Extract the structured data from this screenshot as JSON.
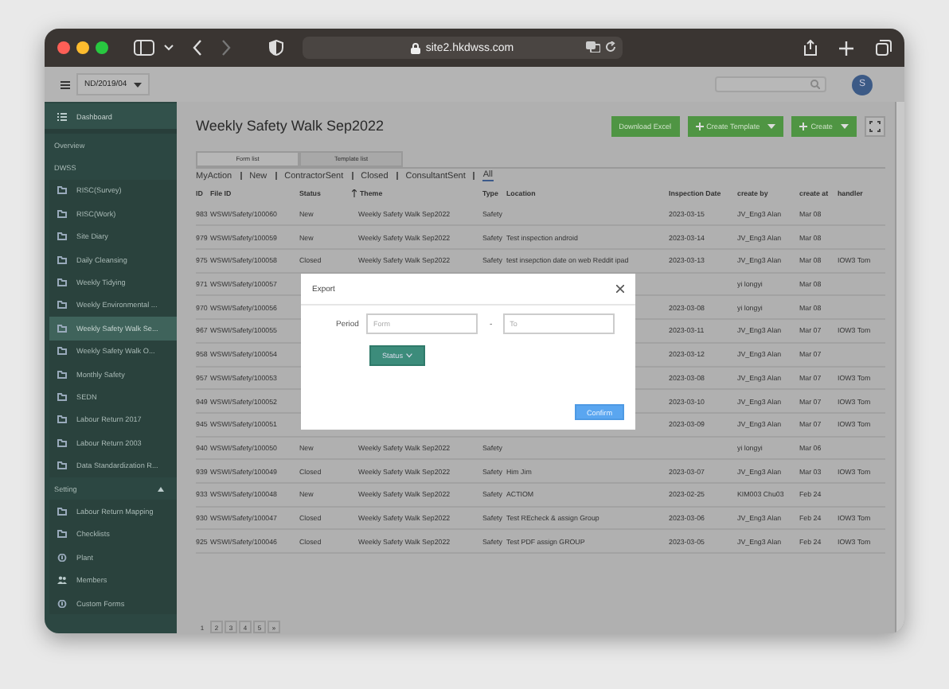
{
  "browser": {
    "url": "site2.hkdwss.com"
  },
  "header": {
    "project": "ND/2019/04",
    "avatar": "S"
  },
  "sidebar": {
    "items": [
      {
        "label": "Dashboard",
        "kind": "list",
        "selected": false
      },
      {
        "label": "Overview",
        "kind": "link",
        "selected": false
      },
      {
        "label": "DWSS",
        "kind": "heading",
        "selected": false
      },
      {
        "label": "RISC(Survey)",
        "kind": "folder",
        "selected": false
      },
      {
        "label": "RISC(Work)",
        "kind": "folder",
        "selected": false
      },
      {
        "label": "Site Diary",
        "kind": "folder",
        "selected": false
      },
      {
        "label": "Daily Cleansing",
        "kind": "folder",
        "selected": false
      },
      {
        "label": "Weekly Tidying",
        "kind": "folder",
        "selected": false
      },
      {
        "label": "Weekly Environmental ...",
        "kind": "folder",
        "selected": false
      },
      {
        "label": "Weekly Safety Walk Se...",
        "kind": "folder",
        "selected": true
      },
      {
        "label": "Weekly Safety Walk O...",
        "kind": "folder",
        "selected": false
      },
      {
        "label": "Monthly Safety",
        "kind": "folder",
        "selected": false
      },
      {
        "label": "SEDN",
        "kind": "folder",
        "selected": false
      },
      {
        "label": "Labour Return 2017",
        "kind": "folder",
        "selected": false
      },
      {
        "label": "Labour Return 2003",
        "kind": "folder",
        "selected": false
      },
      {
        "label": "Data Standardization R...",
        "kind": "folder",
        "selected": false
      },
      {
        "label": "Setting",
        "kind": "heading",
        "selected": false,
        "expanded": true
      },
      {
        "label": "Labour Return Mapping",
        "kind": "folder",
        "selected": false
      },
      {
        "label": "Checklists",
        "kind": "folder",
        "selected": false
      },
      {
        "label": "Plant",
        "kind": "circle",
        "selected": false
      },
      {
        "label": "Members",
        "kind": "people",
        "selected": false
      },
      {
        "label": "Custom Forms",
        "kind": "circle",
        "selected": false
      }
    ]
  },
  "page": {
    "title": "Weekly Safety Walk Sep2022",
    "buttons": [
      {
        "label": "Download Excel",
        "kind": "plain"
      },
      {
        "label": "Create Template",
        "kind": "dropdown"
      },
      {
        "label": "Create",
        "kind": "dropdown"
      }
    ],
    "tabs": [
      {
        "label": "Form list",
        "selected": true
      },
      {
        "label": "Template list",
        "selected": false
      }
    ],
    "filters": [
      {
        "label": "MyAction",
        "selected": false
      },
      {
        "label": "New",
        "selected": false
      },
      {
        "label": "ContractorSent",
        "selected": false
      },
      {
        "label": "Closed",
        "selected": false
      },
      {
        "label": "ConsultantSent",
        "selected": false
      },
      {
        "label": "All",
        "selected": true
      }
    ]
  },
  "table": {
    "columns": [
      "ID",
      "File ID",
      "Status",
      "Theme",
      "Type",
      "Location",
      "Inspection Date",
      "create by",
      "create at",
      "handler"
    ],
    "rows": [
      {
        "id": "983",
        "file_id": "WSWI/Safety/100060",
        "status": "New",
        "theme": "Weekly Safety Walk Sep2022",
        "type": "Safety",
        "date": "2023-03-15",
        "create_by": "JV_Eng3 Alan",
        "create_at": "Mar 08"
      },
      {
        "id": "979",
        "file_id": "WSWI/Safety/100059",
        "status": "New",
        "theme": "Weekly Safety Walk Sep2022",
        "type": "Safety",
        "location": "Test inspection android",
        "date": "2023-03-14",
        "create_by": "JV_Eng3 Alan",
        "create_at": "Mar 08"
      },
      {
        "id": "975",
        "file_id": "WSWI/Safety/100058",
        "status": "Closed",
        "theme": "Weekly Safety Walk Sep2022",
        "type": "Safety",
        "location": "test insepction date on web Reddit ipad",
        "date": "2023-03-13",
        "create_by": "JV_Eng3 Alan",
        "create_at": "Mar 08",
        "handler": "IOW3 Tom"
      },
      {
        "id": "971",
        "file_id": "WSWI/Safety/100057",
        "create_by": "yi longyi",
        "create_at": "Mar 08"
      },
      {
        "id": "970",
        "file_id": "WSWI/Safety/100056",
        "date": "2023-03-08",
        "create_by": "yi longyi",
        "create_at": "Mar 08"
      },
      {
        "id": "967",
        "file_id": "WSWI/Safety/100055",
        "date": "2023-03-11",
        "create_by": "JV_Eng3 Alan",
        "create_at": "Mar 07",
        "handler": "IOW3 Tom"
      },
      {
        "id": "958",
        "file_id": "WSWI/Safety/100054",
        "date": "2023-03-12",
        "create_by": "JV_Eng3 Alan",
        "create_at": "Mar 07"
      },
      {
        "id": "957",
        "file_id": "WSWI/Safety/100053",
        "date": "2023-03-08",
        "create_by": "JV_Eng3 Alan",
        "create_at": "Mar 07",
        "handler": "IOW3 Tom"
      },
      {
        "id": "949",
        "file_id": "WSWI/Safety/100052",
        "date": "2023-03-10",
        "create_by": "JV_Eng3 Alan",
        "create_at": "Mar 07",
        "handler": "IOW3 Tom"
      },
      {
        "id": "945",
        "file_id": "WSWI/Safety/100051",
        "date": "2023-03-09",
        "create_by": "JV_Eng3 Alan",
        "create_at": "Mar 07",
        "handler": "IOW3 Tom"
      },
      {
        "id": "940",
        "file_id": "WSWI/Safety/100050",
        "status": "New",
        "theme": "Weekly Safety Walk Sep2022",
        "type": "Safety",
        "create_by": "yi longyi",
        "create_at": "Mar 06"
      },
      {
        "id": "939",
        "file_id": "WSWI/Safety/100049",
        "status": "Closed",
        "theme": "Weekly Safety Walk Sep2022",
        "type": "Safety",
        "location": "Him Jim",
        "date": "2023-03-07",
        "create_by": "JV_Eng3 Alan",
        "create_at": "Mar 03",
        "handler": "IOW3 Tom"
      },
      {
        "id": "933",
        "file_id": "WSWI/Safety/100048",
        "status": "New",
        "theme": "Weekly Safety Walk Sep2022",
        "type": "Safety",
        "location": "ACTIOM",
        "date": "2023-02-25",
        "create_by": "KIM003 Chu03",
        "create_at": "Feb 24"
      },
      {
        "id": "930",
        "file_id": "WSWI/Safety/100047",
        "status": "Closed",
        "theme": "Weekly Safety Walk Sep2022",
        "type": "Safety",
        "location": "Test REcheck & assign Group",
        "date": "2023-03-06",
        "create_by": "JV_Eng3 Alan",
        "create_at": "Feb 24",
        "handler": "IOW3 Tom"
      },
      {
        "id": "925",
        "file_id": "WSWI/Safety/100046",
        "status": "Closed",
        "theme": "Weekly Safety Walk Sep2022",
        "type": "Safety",
        "location": "Test PDF assign GROUP",
        "date": "2023-03-05",
        "create_by": "JV_Eng3 Alan",
        "create_at": "Feb 24",
        "handler": "IOW3 Tom"
      }
    ]
  },
  "pagination": {
    "pages": [
      {
        "label": "1",
        "selected": true
      },
      {
        "label": "2",
        "selected": false
      },
      {
        "label": "3",
        "selected": false
      },
      {
        "label": "4",
        "selected": false
      },
      {
        "label": "5",
        "selected": false
      }
    ],
    "next": "»"
  },
  "modal": {
    "title": "Export",
    "period_label": "Period",
    "from_placeholder": "Form",
    "separator": "-",
    "to_placeholder": "To",
    "status_button": "Status",
    "confirm": "Confirm"
  }
}
